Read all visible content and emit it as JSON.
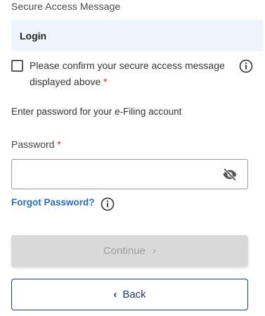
{
  "secure_access": {
    "label": "Secure Access Message",
    "value": "Login"
  },
  "confirm": {
    "text": "Please confirm your secure access message displayed above",
    "required_mark": "*",
    "checked": false,
    "info_icon": "info-icon"
  },
  "password_section": {
    "instruction": "Enter password for your e-Filing account",
    "label": "Password",
    "required_mark": "*",
    "value": "",
    "toggle_icon": "eye-off-icon"
  },
  "forgot": {
    "link_text": "Forgot Password?",
    "info_icon": "info-icon"
  },
  "buttons": {
    "continue_label": "Continue",
    "continue_chevron": "›",
    "continue_disabled": true,
    "back_label": "Back",
    "back_chevron": "‹"
  },
  "colors": {
    "link": "#2a6db5",
    "required": "#c62828",
    "back_border": "#1f3a6e",
    "message_box_bg": "#eef5fd",
    "disabled_button_bg": "#d9d9d9"
  }
}
